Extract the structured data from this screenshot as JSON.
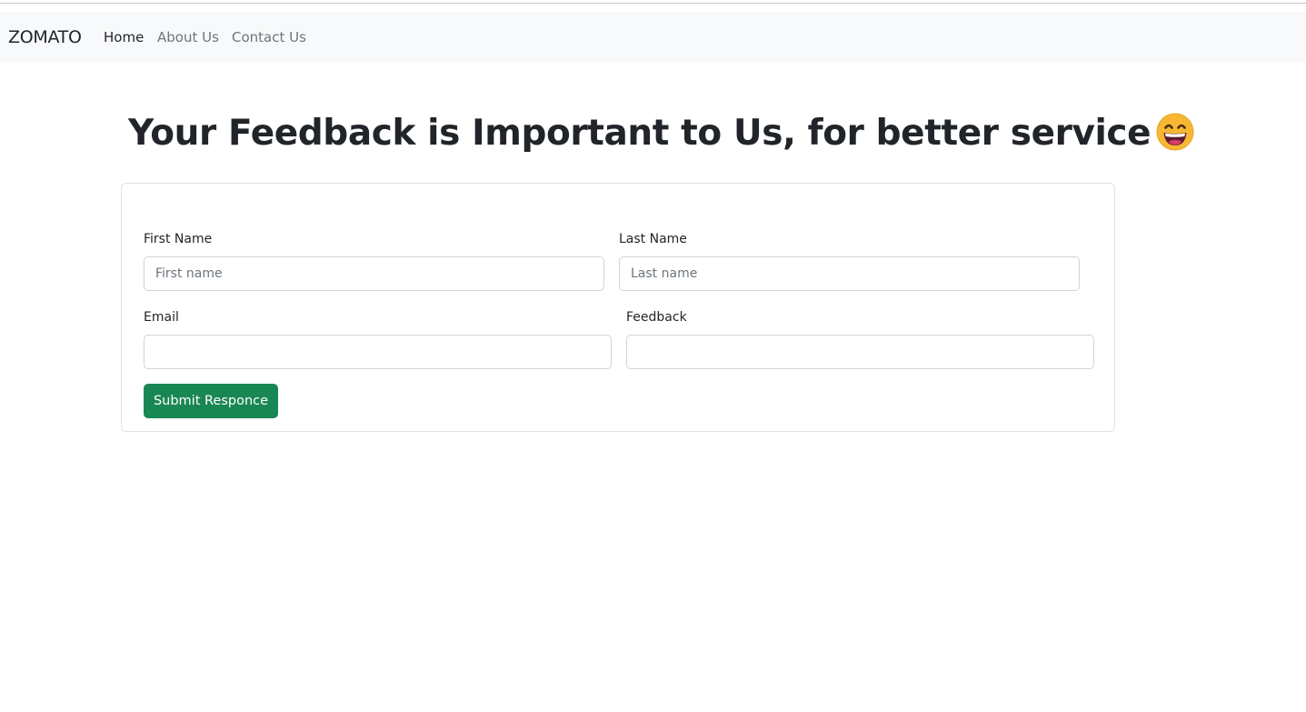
{
  "navbar": {
    "brand": "ZOMATO",
    "links": [
      {
        "label": "Home",
        "active": true
      },
      {
        "label": "About Us",
        "active": false
      },
      {
        "label": "Contact Us",
        "active": false
      }
    ]
  },
  "page": {
    "heading": "Your Feedback is Important to Us, for better service",
    "heading_emoji": "grinning-face-icon"
  },
  "form": {
    "first_name_label": "First Name",
    "first_name_placeholder": "First name",
    "first_name_value": "",
    "last_name_label": "Last Name",
    "last_name_placeholder": "Last name",
    "last_name_value": "",
    "email_label": "Email",
    "email_value": "",
    "feedback_label": "Feedback",
    "feedback_value": "",
    "submit_label": "Submit Responce"
  },
  "colors": {
    "navbar_bg": "#f8f9fa",
    "submit_button": "#198754",
    "text_primary": "#212529",
    "text_muted": "#6c757d"
  }
}
